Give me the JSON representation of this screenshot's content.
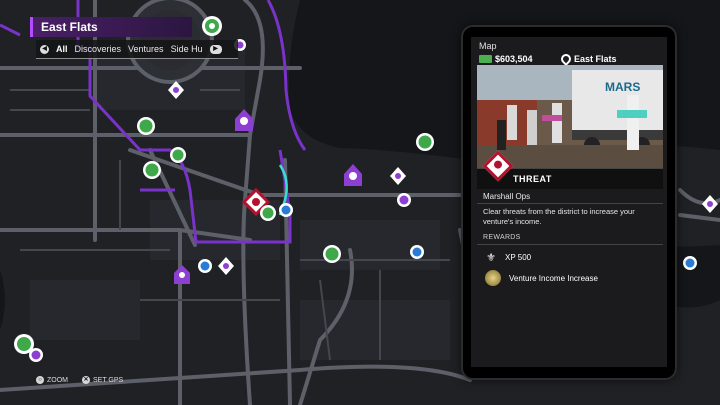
{
  "header": {
    "district": "East Flats",
    "tabs": [
      "All",
      "Discoveries",
      "Ventures",
      "Side Hu"
    ]
  },
  "controls": {
    "zoom_label": "ZOOM",
    "set_gps_label": "SET GPS"
  },
  "phone": {
    "app_title": "Map",
    "money": "$603,504",
    "location": "East Flats",
    "activity_type": "THREAT",
    "mission_name": "Marshall Ops",
    "description": "Clear threats from the district to increase your venture's income.",
    "rewards_header": "REWARDS",
    "rewards": [
      {
        "label": "XP 500"
      },
      {
        "label": "Venture Income Increase"
      }
    ],
    "photo_sign": "MARS"
  },
  "colors": {
    "district_border": "#7a33c9",
    "accent_purple": "#b34dff",
    "threat_red": "#b3122e",
    "gps_cyan": "#35e0d0",
    "cash_green": "#4caf50"
  },
  "icons": [
    "map-marker-icon",
    "threat-icon",
    "cash-icon",
    "pin-icon",
    "fleur-de-lis-icon",
    "venture-icon",
    "weapon-icon",
    "collectible-icon"
  ]
}
